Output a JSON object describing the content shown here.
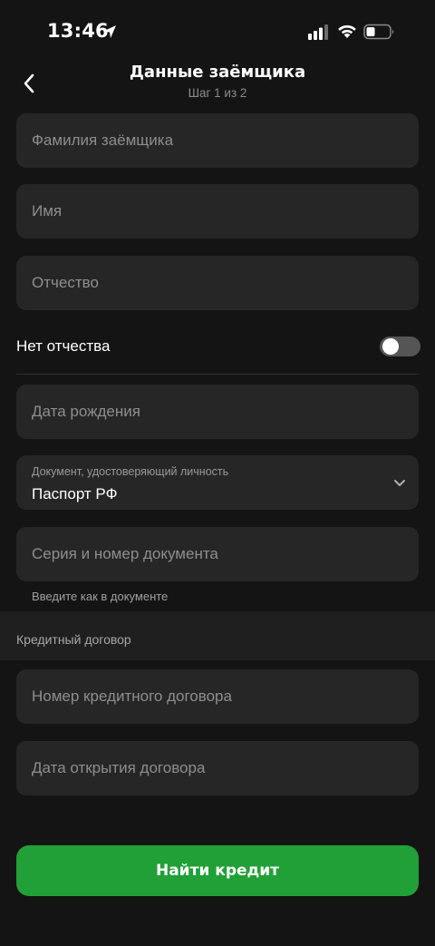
{
  "status_bar": {
    "time": "13:46"
  },
  "header": {
    "title": "Данные заёмщика",
    "subtitle": "Шаг 1 из 2"
  },
  "form": {
    "last_name_placeholder": "Фамилия заёмщика",
    "first_name_placeholder": "Имя",
    "patronymic_placeholder": "Отчество",
    "no_patronymic_label": "Нет отчества",
    "no_patronymic_enabled": false,
    "birth_date_placeholder": "Дата рождения",
    "document_label": "Документ, удостоверяющий личность",
    "document_value": "Паспорт РФ",
    "doc_number_placeholder": "Серия и номер документа",
    "doc_number_hint": "Введите как в документе"
  },
  "credit_section": {
    "title": "Кредитный договор",
    "contract_number_placeholder": "Номер кредитного договора",
    "contract_date_placeholder": "Дата открытия договора"
  },
  "submit_label": "Найти кредит",
  "colors": {
    "background": "#141414",
    "field": "#262626",
    "accent": "#21a038",
    "toggle_off": "#555555"
  }
}
